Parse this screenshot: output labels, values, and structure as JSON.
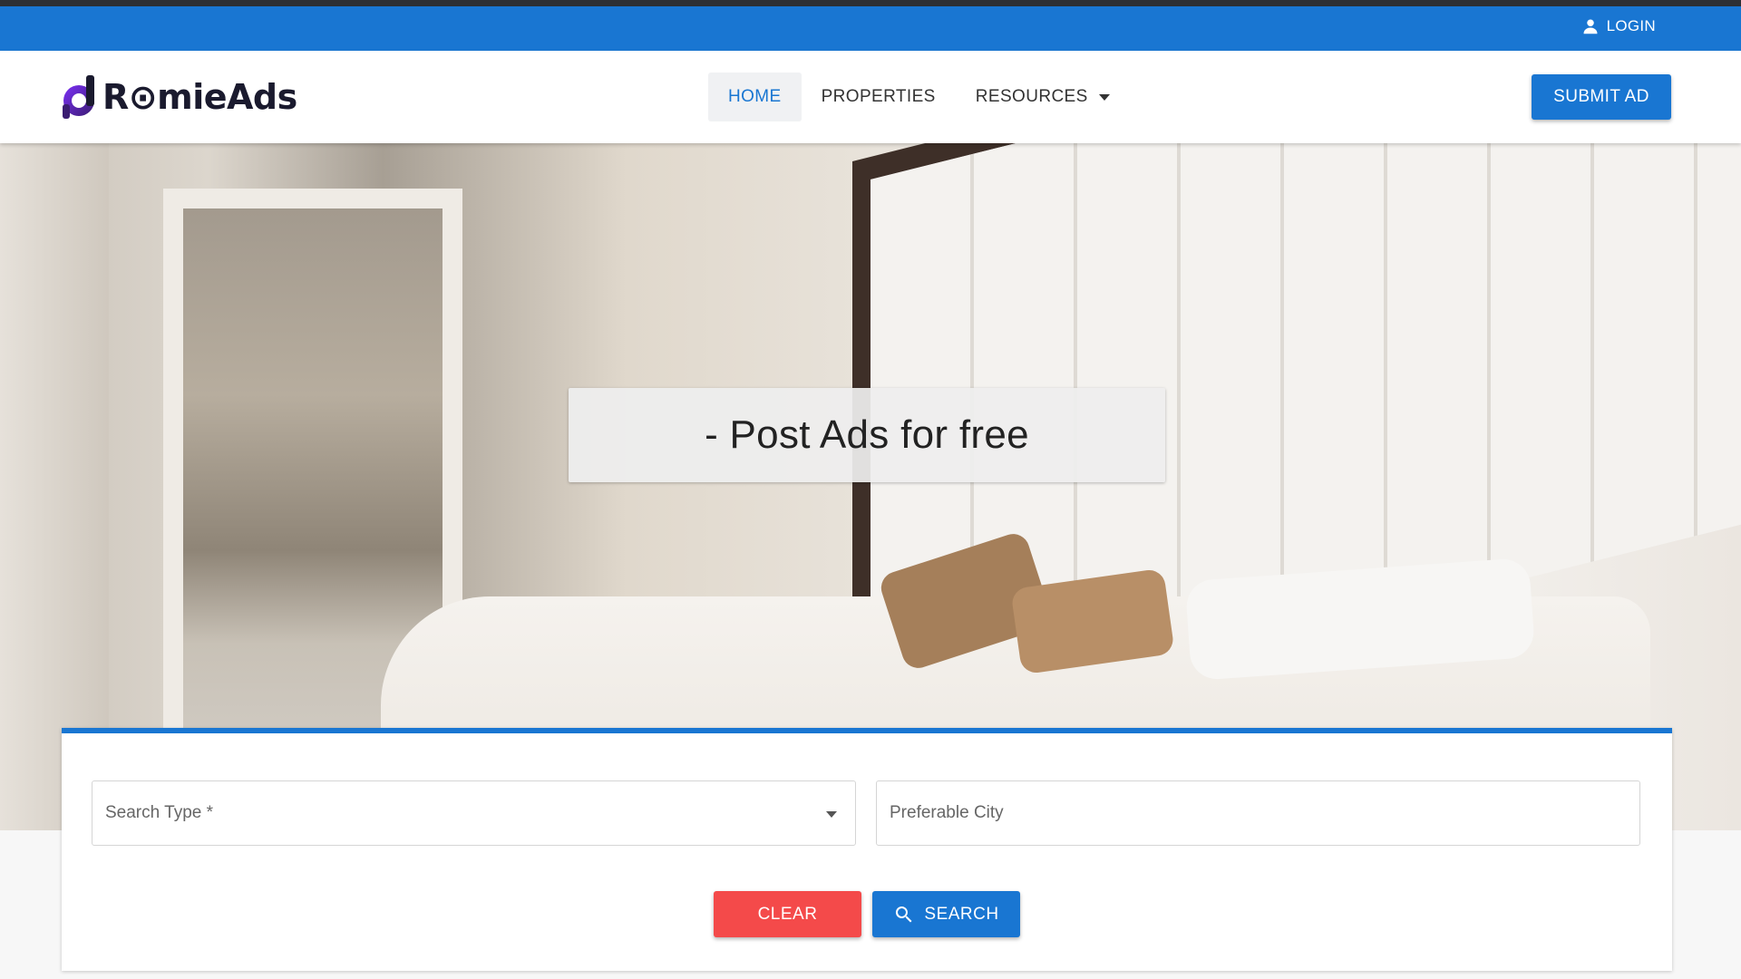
{
  "topbar": {
    "login_label": "LOGIN",
    "login_icon": "person-icon"
  },
  "brand": {
    "name": "RoomieAds",
    "display_text": "R⊙mieAds"
  },
  "nav": {
    "items": [
      {
        "label": "HOME",
        "active": true
      },
      {
        "label": "PROPERTIES",
        "active": false
      },
      {
        "label": "RESOURCES",
        "active": false,
        "has_dropdown": true
      }
    ],
    "submit_label": "SUBMIT AD"
  },
  "hero": {
    "tagline": "- Post Ads for free"
  },
  "search": {
    "type_label": "Search Type *",
    "city_placeholder": "Preferable City",
    "clear_label": "CLEAR",
    "search_label": "SEARCH"
  },
  "colors": {
    "primary": "#1976d2",
    "danger": "#f44a4a",
    "dark_strip": "#2d2f33"
  }
}
